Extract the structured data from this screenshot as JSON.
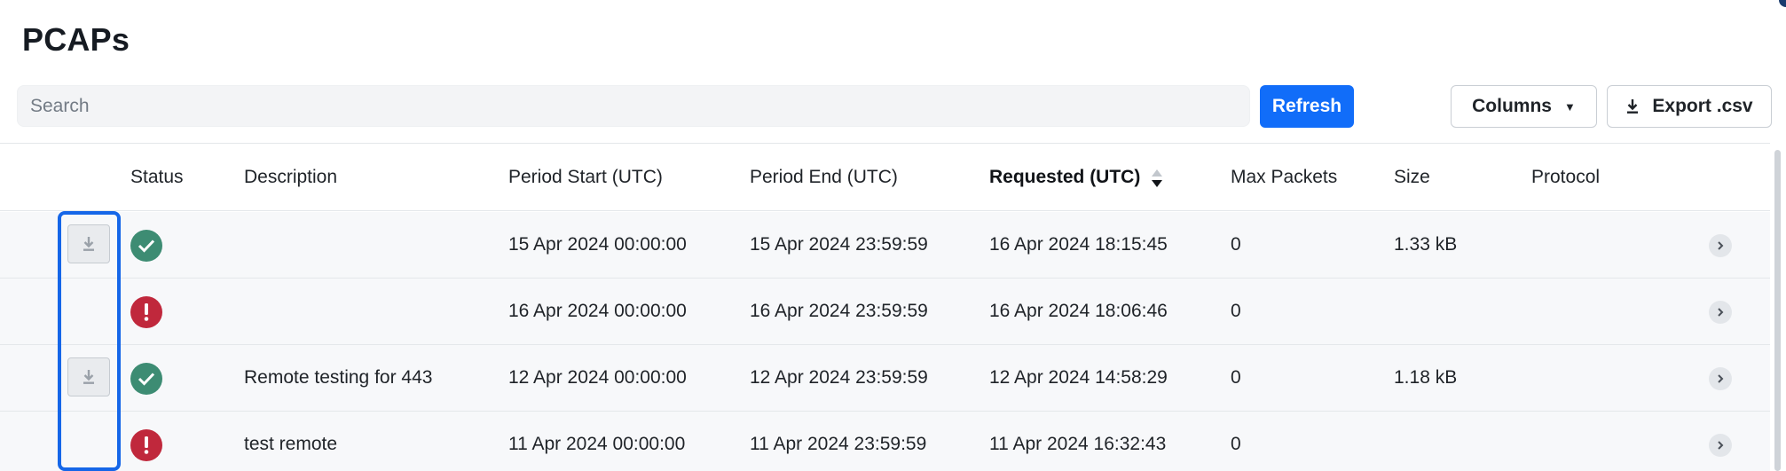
{
  "page": {
    "title": "PCAPs"
  },
  "toolbar": {
    "search_placeholder": "Search",
    "search_value": "",
    "refresh_label": "Refresh",
    "columns_label": "Columns",
    "export_label": "Export .csv"
  },
  "table": {
    "headers": {
      "status": "Status",
      "description": "Description",
      "period_start": "Period Start (UTC)",
      "period_end": "Period End (UTC)",
      "requested": "Requested (UTC)",
      "max_packets": "Max Packets",
      "size": "Size",
      "protocol": "Protocol"
    },
    "sorted_column": "requested",
    "sort_direction": "descending",
    "rows": [
      {
        "downloadable": true,
        "status": "success",
        "description": "",
        "period_start": "15 Apr 2024 00:00:00",
        "period_end": "15 Apr 2024 23:59:59",
        "requested": "16 Apr 2024 18:15:45",
        "max_packets": "0",
        "size": "1.33 kB",
        "protocol": ""
      },
      {
        "downloadable": false,
        "status": "error",
        "description": "",
        "period_start": "16 Apr 2024 00:00:00",
        "period_end": "16 Apr 2024 23:59:59",
        "requested": "16 Apr 2024 18:06:46",
        "max_packets": "0",
        "size": "",
        "protocol": ""
      },
      {
        "downloadable": true,
        "status": "success",
        "description": "Remote testing for 443",
        "period_start": "12 Apr 2024 00:00:00",
        "period_end": "12 Apr 2024 23:59:59",
        "requested": "12 Apr 2024 14:58:29",
        "max_packets": "0",
        "size": "1.18 kB",
        "protocol": ""
      },
      {
        "downloadable": false,
        "status": "error",
        "description": "test remote",
        "period_start": "11 Apr 2024 00:00:00",
        "period_end": "11 Apr 2024 23:59:59",
        "requested": "11 Apr 2024 16:32:43",
        "max_packets": "0",
        "size": "",
        "protocol": ""
      }
    ]
  },
  "icons": {
    "download": "download-icon",
    "success": "check-circle-icon",
    "error": "exclamation-circle-icon",
    "chevron": "chevron-right-icon",
    "caret": "caret-down-icon",
    "sort": "sort-icon"
  },
  "colors": {
    "primary": "#116df9",
    "success": "#3d8c73",
    "error": "#c0283c",
    "highlight": "#1566e8"
  }
}
